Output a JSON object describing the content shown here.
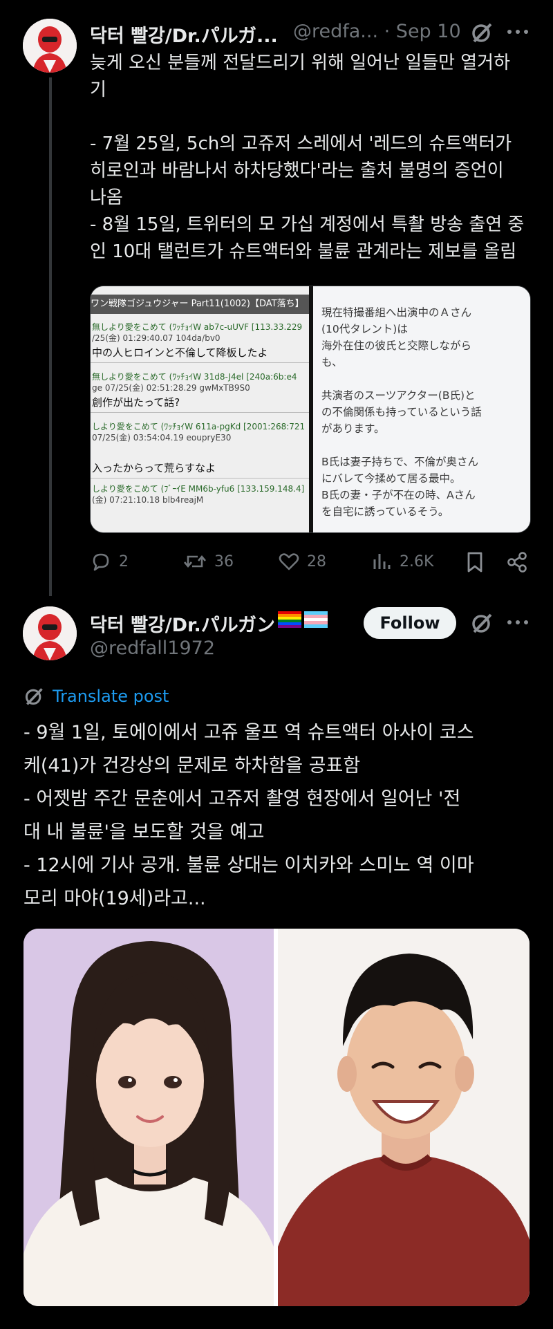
{
  "tweet1": {
    "display_name": "닥터 빨강/Dr.パルガ...",
    "handle_time": "@redfa... · Sep 10",
    "text": "늦게 오신 분들께 전달드리기 위해 일어난 일들만 열거하\n기\n\n- 7월 25일, 5ch의 고쥬저 스레에서 '레드의 슈트액터가\n히로인과 바람나서 하차당했다'라는 출처 불명의 증언이\n나옴\n- 8월 15일, 트위터의 모 가십 계정에서 특촬 방송 출연 중\n인 10대 탤런트가 슈트액터와 불륜 관계라는 제보를 올림",
    "media_left": {
      "header": "ワン戦隊ゴジュウジャー Part11(1002)【DAT落ち】",
      "posts": [
        {
          "meta1": "無しより愛をこめて (ﾜｯﾁｮｲW ab7c-uUVF [113.33.229",
          "meta2": "/25(金) 01:29:40.07 104da/bv0",
          "body": "中の人ヒロインと不倫して降板したよ"
        },
        {
          "meta1": "無しより愛をこめて (ﾜｯﾁｮｲW 31d8-J4el [240a:6b:e4",
          "meta2": "ge 07/25(金) 02:51:28.29 gwMxTB9S0",
          "body": "創作が出たって話?"
        },
        {
          "meta1": "しより愛をこめて (ﾜｯﾁｮｲW 611a-pgKd [2001:268:721",
          "meta2": "07/25(金) 03:54:04.19 eoupryE30",
          "body": "入ったからって荒らすなよ"
        },
        {
          "meta1": "しより愛をこめて (ﾌﾞｰｲE MM6b-yfu6 [133.159.148.4]",
          "meta2": "(金) 07:21:10.18 blb4reajM",
          "body": ""
        }
      ]
    },
    "media_right": {
      "text": "現在特撮番組へ出演中のＡさん\n(10代タレント)は\n海外在住の彼氏と交際しながら\nも、\n\n共演者のスーツアクター(B氏)と\nの不倫関係も持っているという話\nがあります。\n\nB氏は妻子持ちで、不倫が奥さん\nにバレて今揉めて居る最中。\nB氏の妻・子が不在の時、Aさん\nを自宅に誘っているそう。"
    },
    "actions": {
      "replies": "2",
      "reposts": "36",
      "likes": "28",
      "views": "2.6K"
    }
  },
  "tweet2": {
    "display_name": "닥터 빨강/Dr.パルガン",
    "handle": "@redfall1972",
    "follow_label": "Follow",
    "translate_label": "Translate post",
    "text": "- 9월 1일, 토에이에서 고쥬 울프 역 슈트액터 아사이 코스\n케(41)가 건강상의 문제로 하차함을 공표함\n- 어젯밤 주간 문춘에서 고쥬저 촬영 현장에서 일어난 '전\n대 내 불륜'을 보도할 것을 예고\n- 12시에 기사 공개. 불륜 상대는 이치카와 스미노 역 이마\n모리 마야(19세)라고..."
  },
  "colors": {
    "background": "#000000",
    "text": "#e7e9ea",
    "muted": "#71767b",
    "link": "#1d9bf0",
    "avatar_red": "#d7262b"
  },
  "icons": [
    "grok-icon",
    "more-icon",
    "reply-icon",
    "repost-icon",
    "like-icon",
    "views-icon",
    "bookmark-icon",
    "share-icon",
    "translate-icon",
    "rainbow-flag-icon",
    "trans-flag-icon"
  ]
}
